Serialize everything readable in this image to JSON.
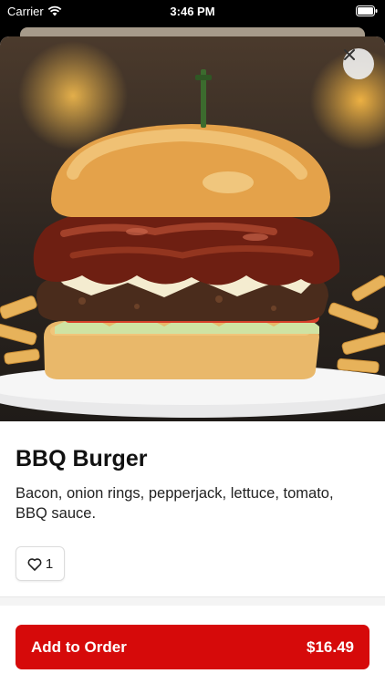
{
  "status_bar": {
    "carrier": "Carrier",
    "time": "3:46 PM"
  },
  "item": {
    "title": "BBQ Burger",
    "description": "Bacon, onion rings, pepperjack, lettuce, tomato, BBQ sauce.",
    "like_count": "1",
    "image_icon": "bbq-burger-photo"
  },
  "order": {
    "label": "Add to Order",
    "price": "$16.49"
  },
  "colors": {
    "accent": "#d60a0a",
    "sheet": "#ffffff",
    "statusbar": "#000000"
  },
  "icons": [
    "wifi-icon",
    "battery-icon",
    "close-icon",
    "heart-icon"
  ]
}
